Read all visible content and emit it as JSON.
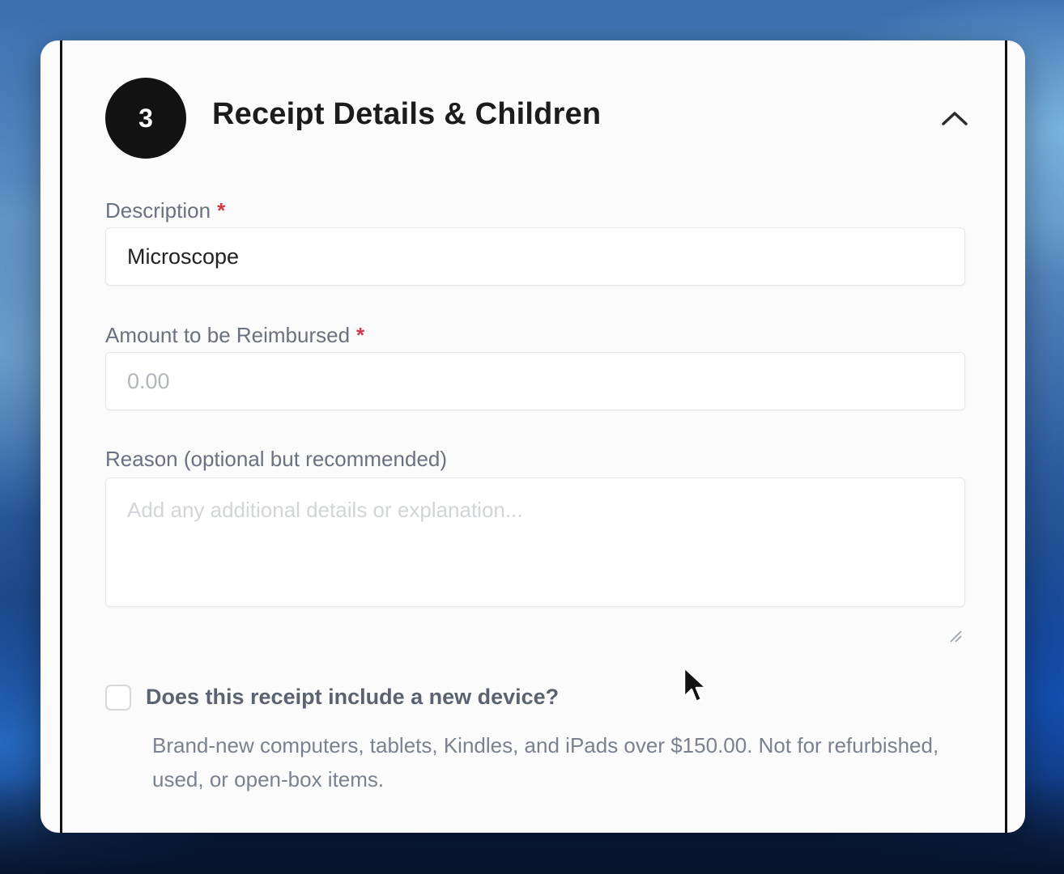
{
  "section": {
    "step_number": "3",
    "title": "Receipt Details & Children"
  },
  "fields": {
    "description": {
      "label": "Description",
      "required_mark": "*",
      "value": "Microscope"
    },
    "amount": {
      "label": "Amount to be Reimbursed",
      "required_mark": "*",
      "value": "",
      "placeholder": "0.00"
    },
    "reason": {
      "label": "Reason (optional but recommended)",
      "value": "",
      "placeholder": "Add any additional details or explanation..."
    }
  },
  "device_checkbox": {
    "checked": false,
    "label": "Does this receipt include a new device?",
    "help_text": "Brand-new computers, tablets, Kindles, and iPads over $150.00. Not for refurbished, used, or open-box items."
  },
  "icons": {
    "collapse": "chevron-up-icon",
    "resize": "resize-grip-icon",
    "pointer": "mouse-pointer-icon"
  },
  "colors": {
    "badge_background": "#121212",
    "required": "#d0384b",
    "label": "#6a7281"
  }
}
